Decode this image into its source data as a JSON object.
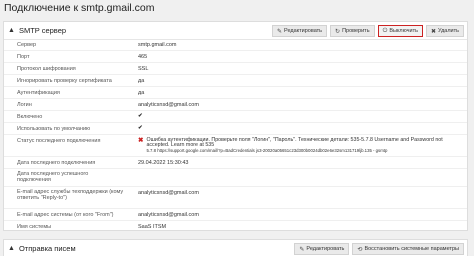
{
  "page": {
    "title": "Подключение к smtp.gmail.com"
  },
  "smtp": {
    "title": "SMTP сервер",
    "buttons": {
      "edit": "Редактировать",
      "test": "Проверить",
      "disable": "Выключить",
      "delete": "Удалить"
    },
    "rows": [
      {
        "label": "Сервер",
        "value": "smtp.gmail.com"
      },
      {
        "label": "Порт",
        "value": "465"
      },
      {
        "label": "Протокол шифрования",
        "value": "SSL"
      },
      {
        "label": "Игнорировать проверку сертификата",
        "value": "да"
      },
      {
        "label": "Аутентификация",
        "value": "да"
      },
      {
        "label": "Логин",
        "value": "analyticsnsd@gmail.com"
      },
      {
        "label": "Включено",
        "value": "✔"
      },
      {
        "label": "Использовать по умолчанию",
        "value": "✔"
      },
      {
        "label": "Статус последнего подключения",
        "error_title": "Ошибка аутентификации. Проверьте поля \"Логин\", \"Пароль\". Технические детали: 535-5.7.8 Username and Password not accepted. Learn more at 535",
        "error_details": "5.7.8 https://support.google.com/mail/?p=BadCredentials js3-20020a05651c23d300b0024db02e6e32sm131719ljb.135 - gsmtp"
      },
      {
        "label": "Дата последнего подключения",
        "value": "29.04.2022 15:30:43"
      },
      {
        "label": "Дата последнего успешного подключения",
        "value": ""
      },
      {
        "label": "E-mail адрес службы техподдержки (кому ответить \"Reply-to\")",
        "value": "analyticsnsd@gmail.com"
      },
      {
        "label": "E-mail адрес системы (от кого \"From\")",
        "value": "analyticsnsd@gmail.com"
      },
      {
        "label": "Имя системы",
        "value": "SaaS ITSM"
      }
    ]
  },
  "send": {
    "title": "Отправка писем",
    "buttons": {
      "edit": "Редактировать",
      "restore": "Восстановить системные параметры"
    }
  },
  "icons": {
    "chevron": "chevron-up-icon",
    "pencil": "pencil-icon",
    "test": "refresh-icon",
    "power": "power-icon",
    "delete": "delete-icon",
    "check": "check-icon",
    "error": "error-x-icon",
    "restore": "restore-icon"
  },
  "colors": {
    "danger": "#cc2222",
    "success": "#2a8a2a"
  }
}
